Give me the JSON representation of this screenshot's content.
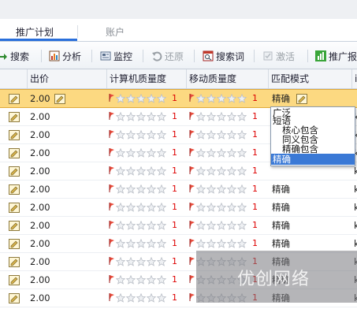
{
  "tabs": [
    "推广计划",
    "账户"
  ],
  "toolbar": {
    "items": [
      {
        "label": "搜索",
        "icon": "search-icon"
      },
      {
        "label": "分析",
        "icon": "chart-icon"
      },
      {
        "label": "监控",
        "icon": "monitor-icon"
      },
      {
        "label": "还原",
        "icon": "undo-icon",
        "disabled": true
      },
      {
        "label": "搜索词",
        "icon": "search-terms-icon"
      },
      {
        "label": "激活",
        "icon": "activate-icon",
        "disabled": true
      },
      {
        "label": "推广报",
        "icon": "report-icon"
      }
    ]
  },
  "table": {
    "columns": [
      "出价",
      "计算机质量度",
      "移动质量度",
      "匹配模式",
      "i"
    ],
    "rows": [
      {
        "price": "2.00",
        "pc_rank": "1",
        "mobile_rank": "1",
        "match": "精确",
        "last": "",
        "selected": true
      },
      {
        "price": "2.00",
        "pc_rank": "1",
        "mobile_rank": "1",
        "match": "",
        "last": "k"
      },
      {
        "price": "2.00",
        "pc_rank": "1",
        "mobile_rank": "1",
        "match": "",
        "last": "k"
      },
      {
        "price": "2.00",
        "pc_rank": "1",
        "mobile_rank": "1",
        "match": "",
        "last": "k"
      },
      {
        "price": "2.00",
        "pc_rank": "1",
        "mobile_rank": "1",
        "match": "",
        "last": "k"
      },
      {
        "price": "2.00",
        "pc_rank": "1",
        "mobile_rank": "1",
        "match": "精确",
        "last": "k"
      },
      {
        "price": "2.00",
        "pc_rank": "1",
        "mobile_rank": "1",
        "match": "精确",
        "last": "k"
      },
      {
        "price": "2.00",
        "pc_rank": "1",
        "mobile_rank": "1",
        "match": "精确",
        "last": "k"
      },
      {
        "price": "2.00",
        "pc_rank": "1",
        "mobile_rank": "1",
        "match": "精确",
        "last": "k"
      },
      {
        "price": "2.00",
        "pc_rank": "1",
        "mobile_rank": "1",
        "match": "精确",
        "last": "k"
      },
      {
        "price": "2.00",
        "pc_rank": "1",
        "mobile_rank": "1",
        "match": "精确",
        "last": "k"
      },
      {
        "price": "2.00",
        "pc_rank": "1",
        "mobile_rank": "1",
        "match": "精确",
        "last": "k"
      }
    ]
  },
  "dropdown": {
    "options": [
      "广泛",
      "短语",
      "核心包含",
      "同义包含",
      "精确包含",
      "精确"
    ],
    "selected": "精确"
  },
  "watermark": "优创网络",
  "colors": {
    "accent": "#2a6fdb",
    "selected_row": "#fcd981",
    "rank": "#dd0000",
    "dropdown_selected": "#3a79d6"
  }
}
